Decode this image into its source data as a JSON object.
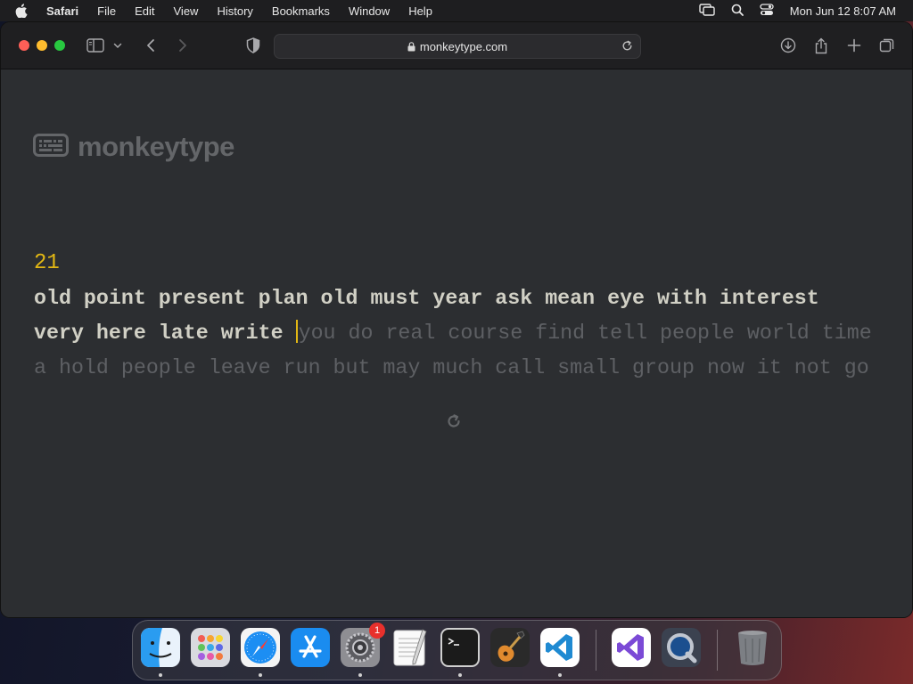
{
  "menubar": {
    "app_name": "Safari",
    "menus": [
      "File",
      "Edit",
      "View",
      "History",
      "Bookmarks",
      "Window",
      "Help"
    ],
    "clock": "Mon Jun 12  8:07 AM",
    "status_icons": [
      "screen-mirroring-icon",
      "spotlight-search-icon",
      "control-center-icon"
    ]
  },
  "browser": {
    "url": "monkeytype.com",
    "toolbar_icons": [
      "sidebar-icon",
      "chevron-down-icon",
      "back-icon",
      "forward-icon",
      "privacy-shield-icon",
      "download-icon",
      "share-icon",
      "new-tab-icon",
      "tab-overview-icon"
    ]
  },
  "page": {
    "logo_text": "monkeytype",
    "word_counter": "21",
    "typed_line_1": "old point present plan old must year ask mean eye with interest",
    "typed_line_2": "very here late write ",
    "untyped_line_2": "you do real course find tell people world time",
    "untyped_line_3": "a hold people leave run but may much call small group now it not go",
    "accent_color": "#e2b714",
    "typed_color": "#d1d0c5",
    "untyped_color": "#5e6064"
  },
  "dock": {
    "apps": [
      "Finder",
      "Launchpad",
      "Safari",
      "App Store",
      "System Settings",
      "TextEdit",
      "Terminal",
      "GarageBand",
      "Visual Studio Code",
      "Visual Studio",
      "QuickTime Player",
      "Trash"
    ],
    "settings_badge": "1"
  }
}
